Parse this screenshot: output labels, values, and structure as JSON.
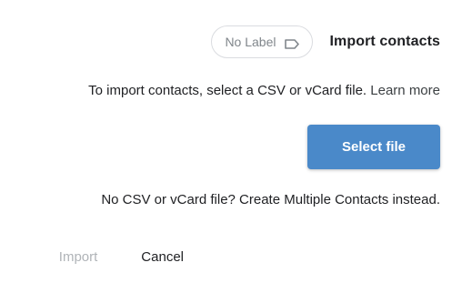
{
  "dialog": {
    "title": "Import contacts",
    "label_chip": {
      "text": "No Label",
      "icon": "label-icon"
    },
    "instructions_prefix": "To import contacts, select a CSV or vCard file. ",
    "learn_more": "Learn more",
    "select_file_label": "Select file",
    "alternative_text": "No CSV or vCard file? Create Multiple Contacts instead.",
    "cancel_label": "Cancel",
    "import_label": "Import"
  },
  "colors": {
    "primary_button": "#4a89c9",
    "disabled_text": "#b0b4b8"
  }
}
